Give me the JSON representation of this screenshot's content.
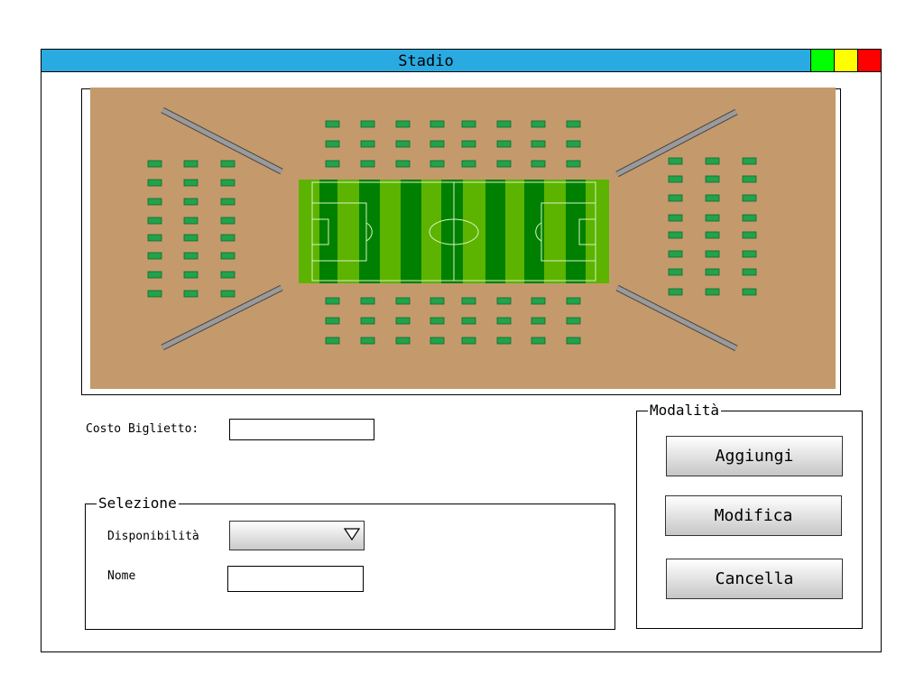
{
  "window": {
    "title": "Stadio",
    "controls": [
      {
        "name": "maximize",
        "color": "#00ff00"
      },
      {
        "name": "minimize",
        "color": "#ffff00"
      },
      {
        "name": "close",
        "color": "#ff0000"
      }
    ]
  },
  "map": {
    "ground_color": "#c49a6c",
    "pitch_color": "#5cb300",
    "pitch_stripe_color": "#008000",
    "seat_color": "#22a24a",
    "stand_color": "#9a9a9a",
    "seat_blocks": [
      {
        "name": "top",
        "rows": 3,
        "cols": 8
      },
      {
        "name": "bottom",
        "rows": 3,
        "cols": 8
      },
      {
        "name": "left",
        "rows": 8,
        "cols": 3
      },
      {
        "name": "right",
        "rows": 8,
        "cols": 3
      }
    ]
  },
  "form": {
    "ticket_cost_label": "Costo Biglietto:",
    "ticket_cost_value": ""
  },
  "selection": {
    "legend": "Selezione",
    "availability_label": "Disponibilità",
    "availability_value": "",
    "name_label": "Nome",
    "name_value": ""
  },
  "mode": {
    "legend": "Modalità",
    "add_label": "Aggiungi",
    "edit_label": "Modifica",
    "delete_label": "Cancella"
  }
}
